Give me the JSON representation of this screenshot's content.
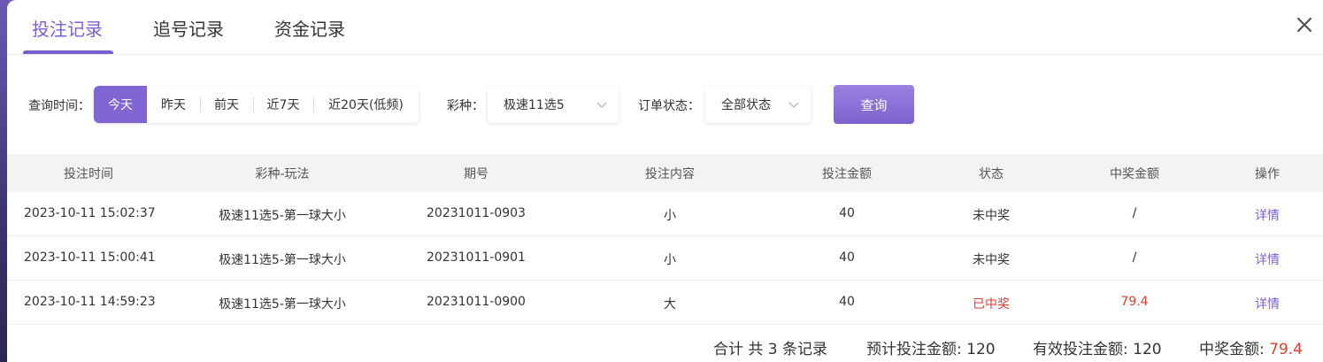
{
  "tabs": [
    {
      "label": "投注记录",
      "active": true
    },
    {
      "label": "追号记录",
      "active": false
    },
    {
      "label": "资金记录",
      "active": false
    }
  ],
  "filters": {
    "time_label": "查询时间：",
    "time_options": [
      "今天",
      "昨天",
      "前天",
      "近7天",
      "近20天(低频)"
    ],
    "time_selected": "今天",
    "lottery_label": "彩种：",
    "lottery_value": "极速11选5",
    "status_label": "订单状态：",
    "status_value": "全部状态",
    "query_label": "查询"
  },
  "table": {
    "headers": [
      "投注时间",
      "彩种-玩法",
      "期号",
      "投注内容",
      "投注金额",
      "状态",
      "中奖金额",
      "操作"
    ],
    "rows": [
      {
        "time": "2023-10-11 15:02:37",
        "game": "极速11选5-第一球大小",
        "issue": "20231011-0903",
        "content": "小",
        "amount": "40",
        "status": "未中奖",
        "win": "/",
        "action": "详情"
      },
      {
        "time": "2023-10-11 15:00:41",
        "game": "极速11选5-第一球大小",
        "issue": "20231011-0901",
        "content": "小",
        "amount": "40",
        "status": "未中奖",
        "win": "/",
        "action": "详情"
      },
      {
        "time": "2023-10-11 14:59:23",
        "game": "极速11选5-第一球大小",
        "issue": "20231011-0900",
        "content": "大",
        "amount": "40",
        "status": "已中奖",
        "win": "79.4",
        "action": "详情"
      }
    ]
  },
  "summary": {
    "total_label": "合计 共 3 条记录",
    "expected_label": "预计投注金额:",
    "expected_value": "120",
    "valid_label": "有效投注金额:",
    "valid_value": "120",
    "win_label": "中奖金额:",
    "win_value": "79.4"
  },
  "colors": {
    "accent": "#7b5fd0",
    "win_red": "#e23b2e"
  }
}
